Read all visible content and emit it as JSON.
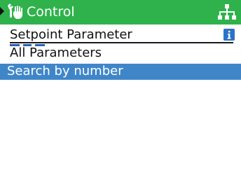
{
  "header": {
    "title": "Control",
    "left_icon": "hand-wrench-icon",
    "right_icon": "network-hierarchy-icon",
    "background_color": "#2fb24c"
  },
  "menu": {
    "items": [
      {
        "label": "Setpoint Parameter",
        "icon": "info-icon",
        "selected": false
      },
      {
        "label": "All Parameters",
        "selected": false
      },
      {
        "label": "Search by number",
        "selected": true
      }
    ],
    "highlight_color": "#3f86c9"
  }
}
